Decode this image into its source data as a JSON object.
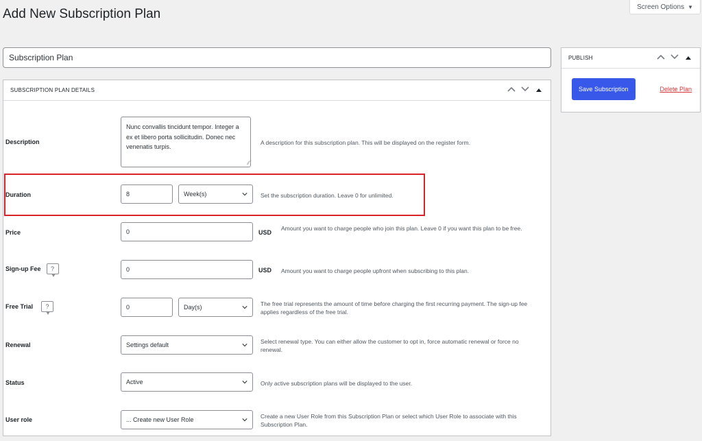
{
  "page": {
    "title": "Add New Subscription Plan",
    "screen_options": "Screen Options"
  },
  "plan_name_input": {
    "value": "Subscription Plan"
  },
  "details_box": {
    "title": "SUBSCRIPTION PLAN DETAILS",
    "rows": {
      "description": {
        "label": "Description",
        "value": "Nunc convallis tincidunt tempor. Integer a ex et libero porta sollicitudin. Donec nec venenatis turpis.",
        "help": "A description for this subscription plan. This will be displayed on the register form."
      },
      "duration": {
        "label": "Duration",
        "value": "8",
        "unit_select": "Week(s)",
        "help": "Set the subscription duration. Leave 0 for unlimited."
      },
      "price": {
        "label": "Price",
        "value": "0",
        "currency": "USD",
        "help": "Amount you want to charge people who join this plan. Leave 0 if you want this plan to be free."
      },
      "signup_fee": {
        "label": "Sign-up Fee",
        "value": "0",
        "currency": "USD",
        "help": "Amount you want to charge people upfront when subscribing to this plan."
      },
      "free_trial": {
        "label": "Free Trial",
        "value": "0",
        "unit_select": "Day(s)",
        "help": "The free trial represents the amount of time before charging the first recurring payment. The sign-up fee applies regardless of the free trial."
      },
      "renewal": {
        "label": "Renewal",
        "select": "Settings default",
        "help": "Select renewal type. You can either allow the customer to opt in, force automatic renewal or force no renewal."
      },
      "status": {
        "label": "Status",
        "select": "Active",
        "help": "Only active subscription plans will be displayed to the user."
      },
      "user_role": {
        "label": "User role",
        "select": "... Create new User Role",
        "help": "Create a new User Role from this Subscription Plan or select which User Role to associate with this Subscription Plan."
      }
    }
  },
  "publish_box": {
    "title": "PUBLISH",
    "save_label": "Save Subscription",
    "delete_label": "Delete Plan"
  },
  "colors": {
    "primary_button": "#3858e9",
    "delete_link": "#d63638",
    "highlight_border": "#d9222a",
    "background": "#f0f0f1"
  },
  "icons": [
    "chevron-up-icon",
    "chevron-down-icon",
    "collapse-arrow-icon",
    "help-icon",
    "select-chevron-icon",
    "resize-grip-icon"
  ]
}
